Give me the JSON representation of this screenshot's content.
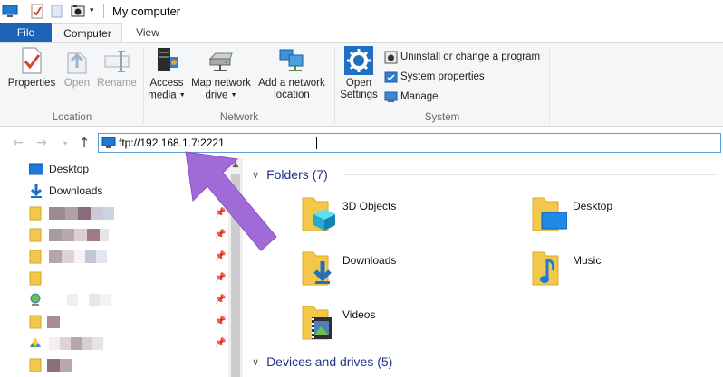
{
  "window": {
    "title": "My computer"
  },
  "tabs": {
    "file": "File",
    "computer": "Computer",
    "view": "View"
  },
  "ribbon": {
    "location": {
      "label": "Location",
      "properties": "Properties",
      "open": "Open",
      "rename": "Rename"
    },
    "network": {
      "label": "Network",
      "access_media_l1": "Access",
      "access_media_l2": "media",
      "map_drive_l1": "Map network",
      "map_drive_l2": "drive",
      "add_location_l1": "Add a network",
      "add_location_l2": "location"
    },
    "system": {
      "label": "System",
      "open_settings_l1": "Open",
      "open_settings_l2": "Settings",
      "uninstall": "Uninstall or change a program",
      "system_properties": "System properties",
      "manage": "Manage"
    }
  },
  "address": {
    "value": "ftp://192.168.1.7:2221"
  },
  "navpane": {
    "items": [
      {
        "label": "Desktop",
        "icon": "desktop-icon"
      },
      {
        "label": "Downloads",
        "icon": "downloads-icon"
      }
    ]
  },
  "content": {
    "folders_header": "Folders (7)",
    "folders": [
      {
        "name": "3D Objects",
        "icon": "3d-objects-folder-icon"
      },
      {
        "name": "Desktop",
        "icon": "desktop-folder-icon"
      },
      {
        "name": "Downloads",
        "icon": "downloads-folder-icon"
      },
      {
        "name": "Music",
        "icon": "music-folder-icon"
      },
      {
        "name": "Videos",
        "icon": "videos-folder-icon"
      }
    ],
    "devices_header": "Devices and drives (5)"
  },
  "colors": {
    "accent": "#1a63b6",
    "section_header": "#1e3287",
    "folder_yellow": "#f3c84a",
    "annotation_arrow": "#a06bd6"
  }
}
